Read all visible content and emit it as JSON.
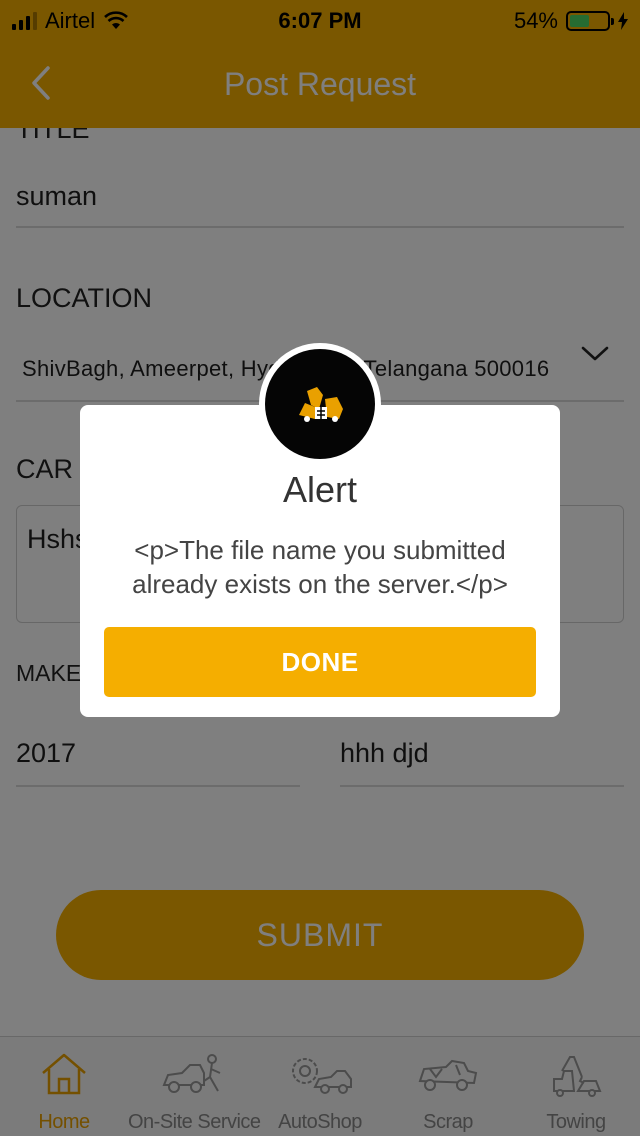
{
  "status_bar": {
    "carrier": "Airtel",
    "time": "6:07 PM",
    "battery_percent": "54%",
    "battery_level": 0.54
  },
  "nav": {
    "title": "Post Request",
    "back_icon": "chevron-left-icon"
  },
  "form": {
    "title_label": "TITLE",
    "title_value": "suman",
    "location_label": "LOCATION",
    "location_value": "ShivBagh, Ameerpet, Hyderabad, Telangana 500016",
    "car_label": "CAR",
    "description_value": "Hshs",
    "make_label": "MAKE",
    "year_value": "2017",
    "model_value": "hhh djd",
    "submit_label": "SUBMIT"
  },
  "tabs": [
    {
      "label": "Home",
      "icon": "home-icon",
      "active": true
    },
    {
      "label": "On-Site Service",
      "icon": "on-site-service-icon",
      "active": false
    },
    {
      "label": "AutoShop",
      "icon": "autoshop-icon",
      "active": false
    },
    {
      "label": "Scrap",
      "icon": "scrap-icon",
      "active": false
    },
    {
      "label": "Towing",
      "icon": "towing-icon",
      "active": false
    }
  ],
  "alert": {
    "title": "Alert",
    "message": "<p>The file name you submitted already exists on the server.</p>",
    "button": "DONE",
    "logo_icon": "app-logo-icon"
  },
  "colors": {
    "brand": "#f5ae00",
    "active_tab": "#e9a000",
    "overlay": "rgba(0,0,0,0.5)"
  }
}
